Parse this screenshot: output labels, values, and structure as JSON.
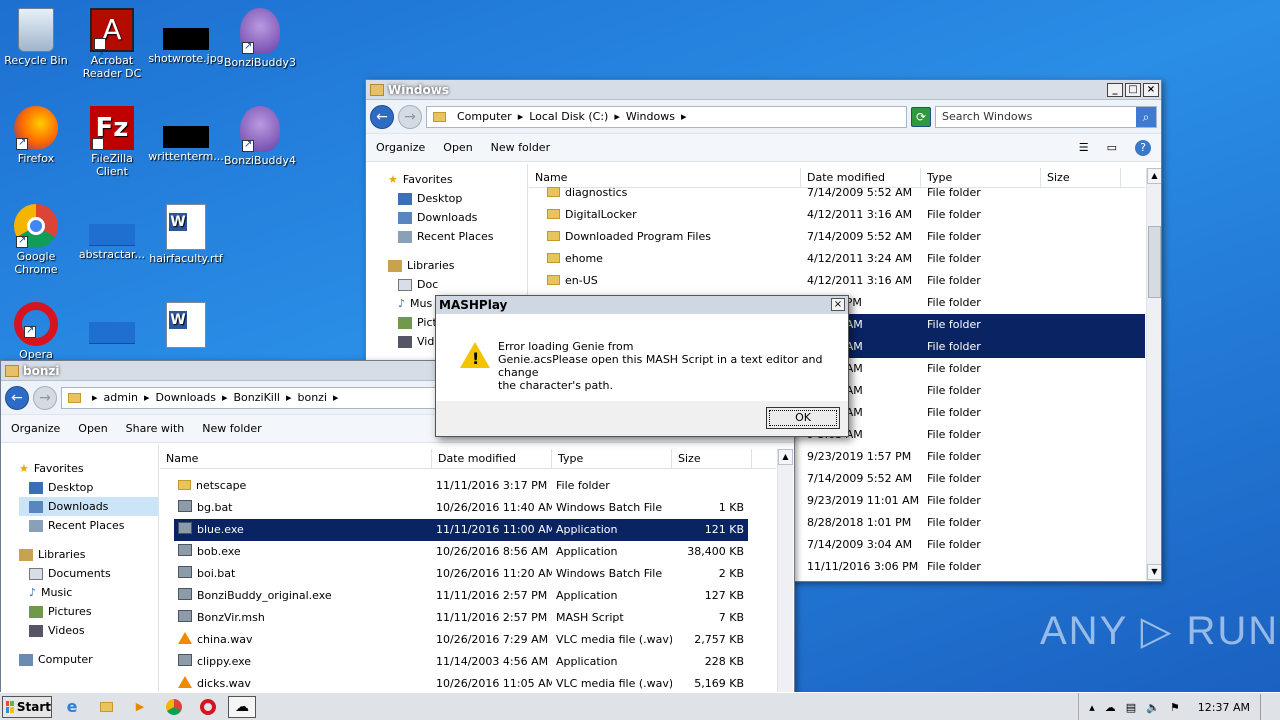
{
  "desktop_icons": [
    {
      "label": "Recycle Bin"
    },
    {
      "label": "Acrobat Reader DC"
    },
    {
      "label": "shotwrote.jpg"
    },
    {
      "label": "BonziBuddy3"
    },
    {
      "label": "Firefox"
    },
    {
      "label": "FileZilla Client"
    },
    {
      "label": "writtenterm..."
    },
    {
      "label": "BonziBuddy4"
    },
    {
      "label": "Google Chrome"
    },
    {
      "label": "abstractar..."
    },
    {
      "label": "hairfaculty.rtf"
    },
    {
      "label": "Opera"
    }
  ],
  "win_windows": {
    "title": "Windows",
    "crumbs": [
      "Computer",
      "Local Disk (C:)",
      "Windows"
    ],
    "search_placeholder": "Search Windows",
    "toolbar": {
      "organize": "Organize",
      "open": "Open",
      "new_folder": "New folder"
    },
    "nav": {
      "favorites": "Favorites",
      "desktop": "Desktop",
      "downloads": "Downloads",
      "recent": "Recent Places",
      "libraries": "Libraries",
      "documents": "Doc",
      "music": "Mus",
      "pictures": "Pict",
      "videos": "Vide"
    },
    "columns": {
      "name": "Name",
      "date": "Date modified",
      "type": "Type",
      "size": "Size"
    },
    "rows": [
      {
        "name": "diagnostics",
        "date": "7/14/2009 5:52 AM",
        "type": "File folder"
      },
      {
        "name": "DigitalLocker",
        "date": "4/12/2011 3:16 AM",
        "type": "File folder"
      },
      {
        "name": "Downloaded Program Files",
        "date": "7/14/2009 5:52 AM",
        "type": "File folder"
      },
      {
        "name": "ehome",
        "date": "4/12/2011 3:24 AM",
        "type": "File folder"
      },
      {
        "name": "en-US",
        "date": "4/12/2011 3:16 AM",
        "type": "File folder"
      },
      {
        "name": "",
        "date": "9 2:00 PM",
        "type": "File folder"
      },
      {
        "name": "",
        "date": "1 3:27 AM",
        "type": "File folder"
      },
      {
        "name": "",
        "date": "1 3:16 AM",
        "type": "File folder"
      },
      {
        "name": "",
        "date": "1 3:16 AM",
        "type": "File folder"
      },
      {
        "name": "",
        "date": "0 7:33 AM",
        "type": "File folder"
      },
      {
        "name": "",
        "date": "9 5:52 AM",
        "type": "File folder"
      },
      {
        "name": "",
        "date": "9 3:03 AM",
        "type": "File folder"
      },
      {
        "name": "",
        "date": "9/23/2019 1:57 PM",
        "type": "File folder"
      },
      {
        "name": "",
        "date": "7/14/2009 5:52 AM",
        "type": "File folder"
      },
      {
        "name": "",
        "date": "9/23/2019 11:01 AM",
        "type": "File folder"
      },
      {
        "name": "",
        "date": "8/28/2018 1:01 PM",
        "type": "File folder"
      },
      {
        "name": "",
        "date": "7/14/2009 3:04 AM",
        "type": "File folder"
      },
      {
        "name": "",
        "date": "11/11/2016 3:06 PM",
        "type": "File folder"
      }
    ]
  },
  "win_bonzi": {
    "title": "bonzi",
    "crumbs": [
      "admin",
      "Downloads",
      "BonziKill",
      "bonzi"
    ],
    "toolbar": {
      "organize": "Organize",
      "open": "Open",
      "share": "Share with",
      "new_folder": "New folder"
    },
    "nav": {
      "favorites": "Favorites",
      "desktop": "Desktop",
      "downloads": "Downloads",
      "recent": "Recent Places",
      "libraries": "Libraries",
      "documents": "Documents",
      "music": "Music",
      "pictures": "Pictures",
      "videos": "Videos",
      "computer": "Computer"
    },
    "columns": {
      "name": "Name",
      "date": "Date modified",
      "type": "Type",
      "size": "Size"
    },
    "rows": [
      {
        "name": "netscape",
        "date": "11/11/2016 3:17 PM",
        "type": "File folder",
        "size": "",
        "icon": "folder"
      },
      {
        "name": "bg.bat",
        "date": "10/26/2016 11:40 AM",
        "type": "Windows Batch File",
        "size": "1 KB",
        "icon": "bat"
      },
      {
        "name": "blue.exe",
        "date": "11/11/2016 11:00 AM",
        "type": "Application",
        "size": "121 KB",
        "icon": "app"
      },
      {
        "name": "bob.exe",
        "date": "10/26/2016 8:56 AM",
        "type": "Application",
        "size": "38,400 KB",
        "icon": "app"
      },
      {
        "name": "boi.bat",
        "date": "10/26/2016 11:20 AM",
        "type": "Windows Batch File",
        "size": "2 KB",
        "icon": "bat"
      },
      {
        "name": "BonziBuddy_original.exe",
        "date": "11/11/2016 2:57 PM",
        "type": "Application",
        "size": "127 KB",
        "icon": "app"
      },
      {
        "name": "BonzVir.msh",
        "date": "11/11/2016 2:57 PM",
        "type": "MASH Script",
        "size": "7 KB",
        "icon": "app"
      },
      {
        "name": "china.wav",
        "date": "10/26/2016 7:29 AM",
        "type": "VLC media file (.wav)",
        "size": "2,757 KB",
        "icon": "vlc"
      },
      {
        "name": "clippy.exe",
        "date": "11/14/2003 4:56 AM",
        "type": "Application",
        "size": "228 KB",
        "icon": "app"
      },
      {
        "name": "dicks.wav",
        "date": "10/26/2016 11:05 AM",
        "type": "VLC media file (.wav)",
        "size": "5,169 KB",
        "icon": "vlc"
      }
    ]
  },
  "dialog": {
    "title": "MASHPlay",
    "line1": "Error loading Genie from",
    "line2": "Genie.acsPlease open this MASH Script in a text editor and change",
    "line3": "the character's path.",
    "ok": "OK"
  },
  "taskbar": {
    "start": "Start",
    "time": "12:37 AM"
  },
  "watermark": "ANY ▷ RUN"
}
